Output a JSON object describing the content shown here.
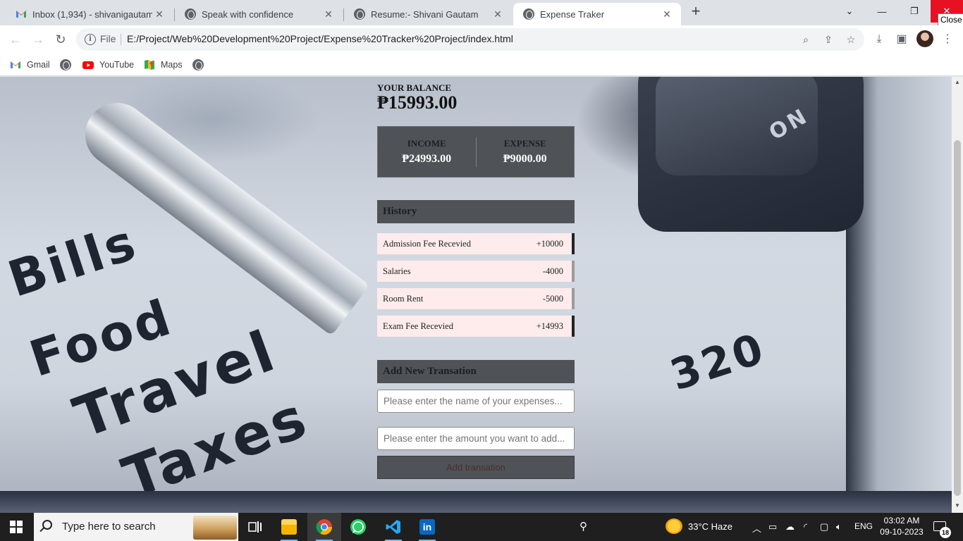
{
  "browser": {
    "tabs": [
      {
        "title": "Inbox (1,934) - shivanigautam73",
        "favicon": "gmail-icon"
      },
      {
        "title": "Speak with confidence",
        "favicon": "globe-icon"
      },
      {
        "title": "Resume:- Shivani Gautam",
        "favicon": "globe-icon"
      },
      {
        "title": "Expense Traker",
        "favicon": "globe-icon",
        "active": true
      }
    ],
    "new_tab": "+",
    "close_tooltip": "Close",
    "scheme": "File",
    "url": "E:/Project/Web%20Development%20Project/Expense%20Tracker%20Project/index.html",
    "bookmarks": [
      {
        "label": "Gmail",
        "icon": "gmail-icon"
      },
      {
        "label": "",
        "icon": "globe-icon"
      },
      {
        "label": "YouTube",
        "icon": "youtube-icon"
      },
      {
        "label": "Maps",
        "icon": "maps-icon"
      },
      {
        "label": "",
        "icon": "globe-icon"
      }
    ]
  },
  "app": {
    "balance_label": "YOUR BALANCE",
    "balance_value": "₱15993.00",
    "income_label": "INCOME",
    "income_value": "₱24993.00",
    "expense_label": "EXPENSE",
    "expense_value": "₱9000.00",
    "history_title": "History",
    "history": [
      {
        "name": "Admission Fee Recevied",
        "amount": "+10000",
        "type": "income"
      },
      {
        "name": "Salaries",
        "amount": "-4000",
        "type": "expense"
      },
      {
        "name": "Room Rent",
        "amount": "-5000",
        "type": "expense"
      },
      {
        "name": "Exam Fee Recevied",
        "amount": "+14993",
        "type": "income"
      }
    ],
    "add_title": "Add New Transation",
    "name_placeholder": "Please enter the name of your expenses...",
    "amount_placeholder": "Please enter the amount you want to add...",
    "add_button": "Add transation"
  },
  "background_words": [
    "Bills",
    "Food",
    "Travel",
    "Taxes",
    "320",
    "ON"
  ],
  "taskbar": {
    "search_placeholder": "Type here to search",
    "weather": "33°C  Haze",
    "language": "ENG",
    "time": "03:02 AM",
    "date": "09-10-2023",
    "notifications": "18"
  }
}
